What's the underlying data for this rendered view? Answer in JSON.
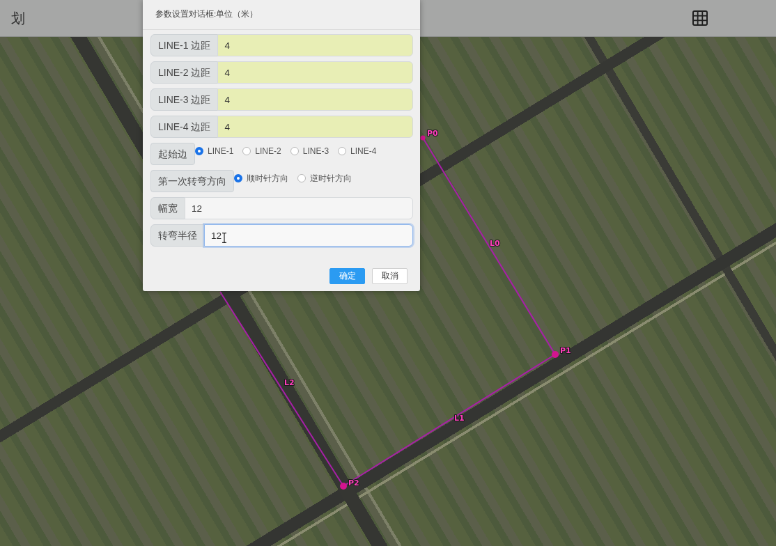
{
  "top_bar": {
    "title": "划"
  },
  "map": {
    "points": [
      {
        "label": "P0"
      },
      {
        "label": "P1"
      },
      {
        "label": "P2"
      }
    ],
    "edges": [
      {
        "label": "L0"
      },
      {
        "label": "L1"
      },
      {
        "label": "L2"
      }
    ]
  },
  "dialog": {
    "title": "参数设置对话框:单位（米）",
    "rows": [
      {
        "kind": "input",
        "label": "LINE-1 边距",
        "value": "4",
        "autofilled": true,
        "focused": false
      },
      {
        "kind": "input",
        "label": "LINE-2 边距",
        "value": "4",
        "autofilled": true,
        "focused": false
      },
      {
        "kind": "input",
        "label": "LINE-3 边距",
        "value": "4",
        "autofilled": true,
        "focused": false
      },
      {
        "kind": "input",
        "label": "LINE-4 边距",
        "value": "4",
        "autofilled": true,
        "focused": false
      },
      {
        "kind": "radio",
        "label": "起始边",
        "options": [
          {
            "label": "LINE-1",
            "selected": true
          },
          {
            "label": "LINE-2",
            "selected": false
          },
          {
            "label": "LINE-3",
            "selected": false
          },
          {
            "label": "LINE-4",
            "selected": false
          }
        ]
      },
      {
        "kind": "radio",
        "label": "第一次转弯方向",
        "options": [
          {
            "label": "顺时针方向",
            "selected": true
          },
          {
            "label": "逆时针方向",
            "selected": false
          }
        ]
      },
      {
        "kind": "input",
        "label": "幅宽",
        "value": "12",
        "autofilled": false,
        "focused": false
      },
      {
        "kind": "input",
        "label": "转弯半径",
        "value": "12",
        "autofilled": false,
        "focused": true
      }
    ],
    "buttons": [
      {
        "label": "确定",
        "kind": "primary"
      },
      {
        "label": "取消",
        "kind": "default"
      }
    ]
  },
  "mouse_pointer": {
    "kind": "i-beam"
  }
}
